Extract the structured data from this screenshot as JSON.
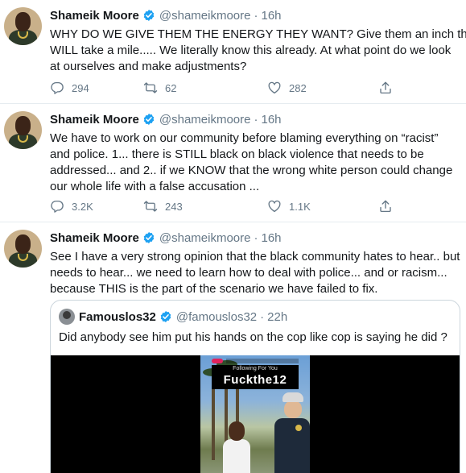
{
  "colors": {
    "verified": "#1da1f2",
    "secondary_text": "#657786",
    "primary_text": "#14171a",
    "divider": "#e6ecf0"
  },
  "icons": {
    "reply": "comment-bubble-icon",
    "retweet": "retweet-arrows-icon",
    "like": "heart-outline-icon",
    "share": "share-upload-icon",
    "verified": "verified-badge-icon"
  },
  "tweets": [
    {
      "name": "Shameik Moore",
      "handle": "@shameikmoore",
      "separator": "·",
      "time": "16h",
      "lines": [
        "WHY DO WE GIVE THEM THE ENERGY THEY WANT? Give them an inch they",
        "WILL take a mile..... We literally know this already. At what point do we look",
        "at ourselves and make adjustments?"
      ],
      "replies": "294",
      "retweets": "62",
      "likes": "282"
    },
    {
      "name": "Shameik Moore",
      "handle": "@shameikmoore",
      "separator": "·",
      "time": "16h",
      "lines": [
        "We have to work on our community before blaming everything on “racist”",
        "and police. 1...  there is STILL black on black violence that needs to be",
        "addressed... and 2.. if we KNOW that the wrong white person could change",
        "our whole life with a false accusation ..."
      ],
      "replies": "3.2K",
      "retweets": "243",
      "likes": "1.1K"
    },
    {
      "name": "Shameik Moore",
      "handle": "@shameikmoore",
      "separator": "·",
      "time": "16h",
      "lines": [
        "See I have a very strong opinion that the black community hates to hear.. but",
        "needs to hear... we need to learn how to deal with police... and or racism...",
        "because THIS is the part of the scenario we have failed to fix."
      ],
      "quote": {
        "name": "Famouslos32",
        "handle": "@famouslos32",
        "separator": "·",
        "time": "22h",
        "text": "Did anybody see him put his hands on the cop like cop is saying he did ?",
        "video_overlay_sub": "Following   For You",
        "video_overlay_text": "Fuckthe12"
      }
    }
  ]
}
